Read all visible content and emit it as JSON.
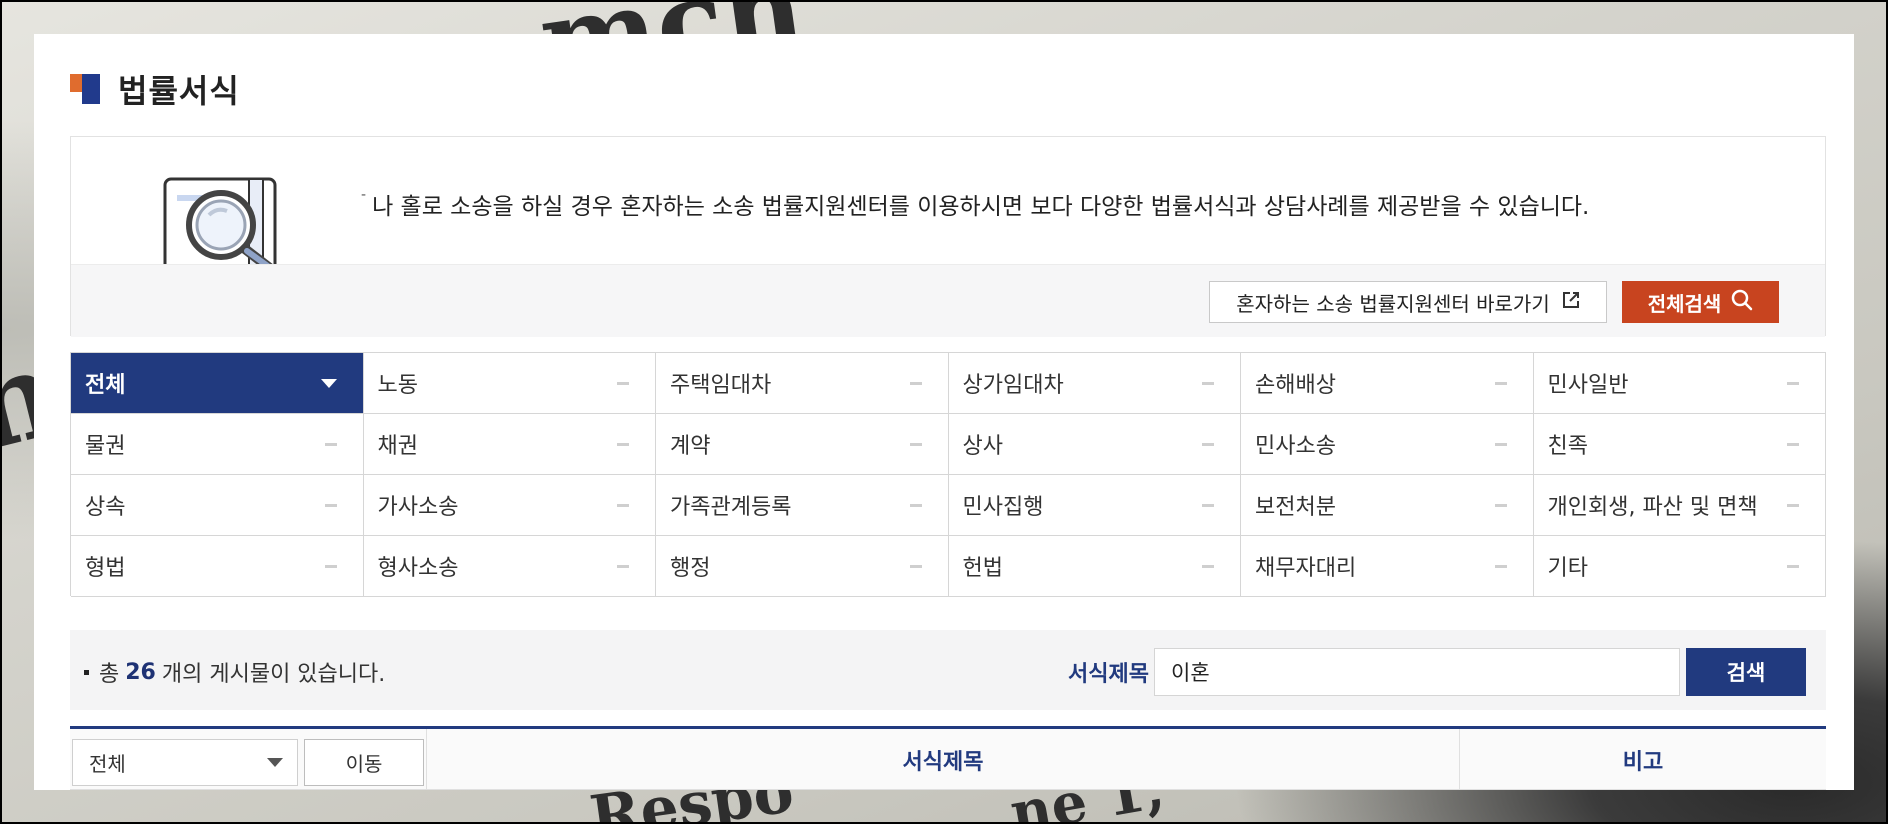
{
  "page": {
    "title": "법률서식",
    "info_text": "나 홀로 소송을 하실 경우 혼자하는 소송 법률지원센터를 이용하시면 보다 다양한 법률서식과 상담사례를 제공받을 수 있습니다.",
    "link_button": "혼자하는 소송 법률지원센터 바로가기",
    "search_all_button": "전체검색"
  },
  "categories": [
    "전체",
    "노동",
    "주택임대차",
    "상가임대차",
    "손해배상",
    "민사일반",
    "물권",
    "채권",
    "계약",
    "상사",
    "민사소송",
    "친족",
    "상속",
    "가사소송",
    "가족관계등록",
    "민사집행",
    "보전처분",
    "개인회생, 파산 및 면책",
    "형법",
    "형사소송",
    "행정",
    "헌법",
    "채무자대리",
    "기타"
  ],
  "active_category": "전체",
  "search": {
    "count_prefix": "총",
    "count": "26",
    "count_suffix": "개의 게시물이 있습니다.",
    "label": "서식제목",
    "value": "이혼",
    "button": "검색"
  },
  "table": {
    "select_value": "전체",
    "move_button": "이동",
    "col_title": "서식제목",
    "col_note": "비고"
  },
  "colors": {
    "primary": "#213a7f",
    "accent": "#c8441f"
  }
}
